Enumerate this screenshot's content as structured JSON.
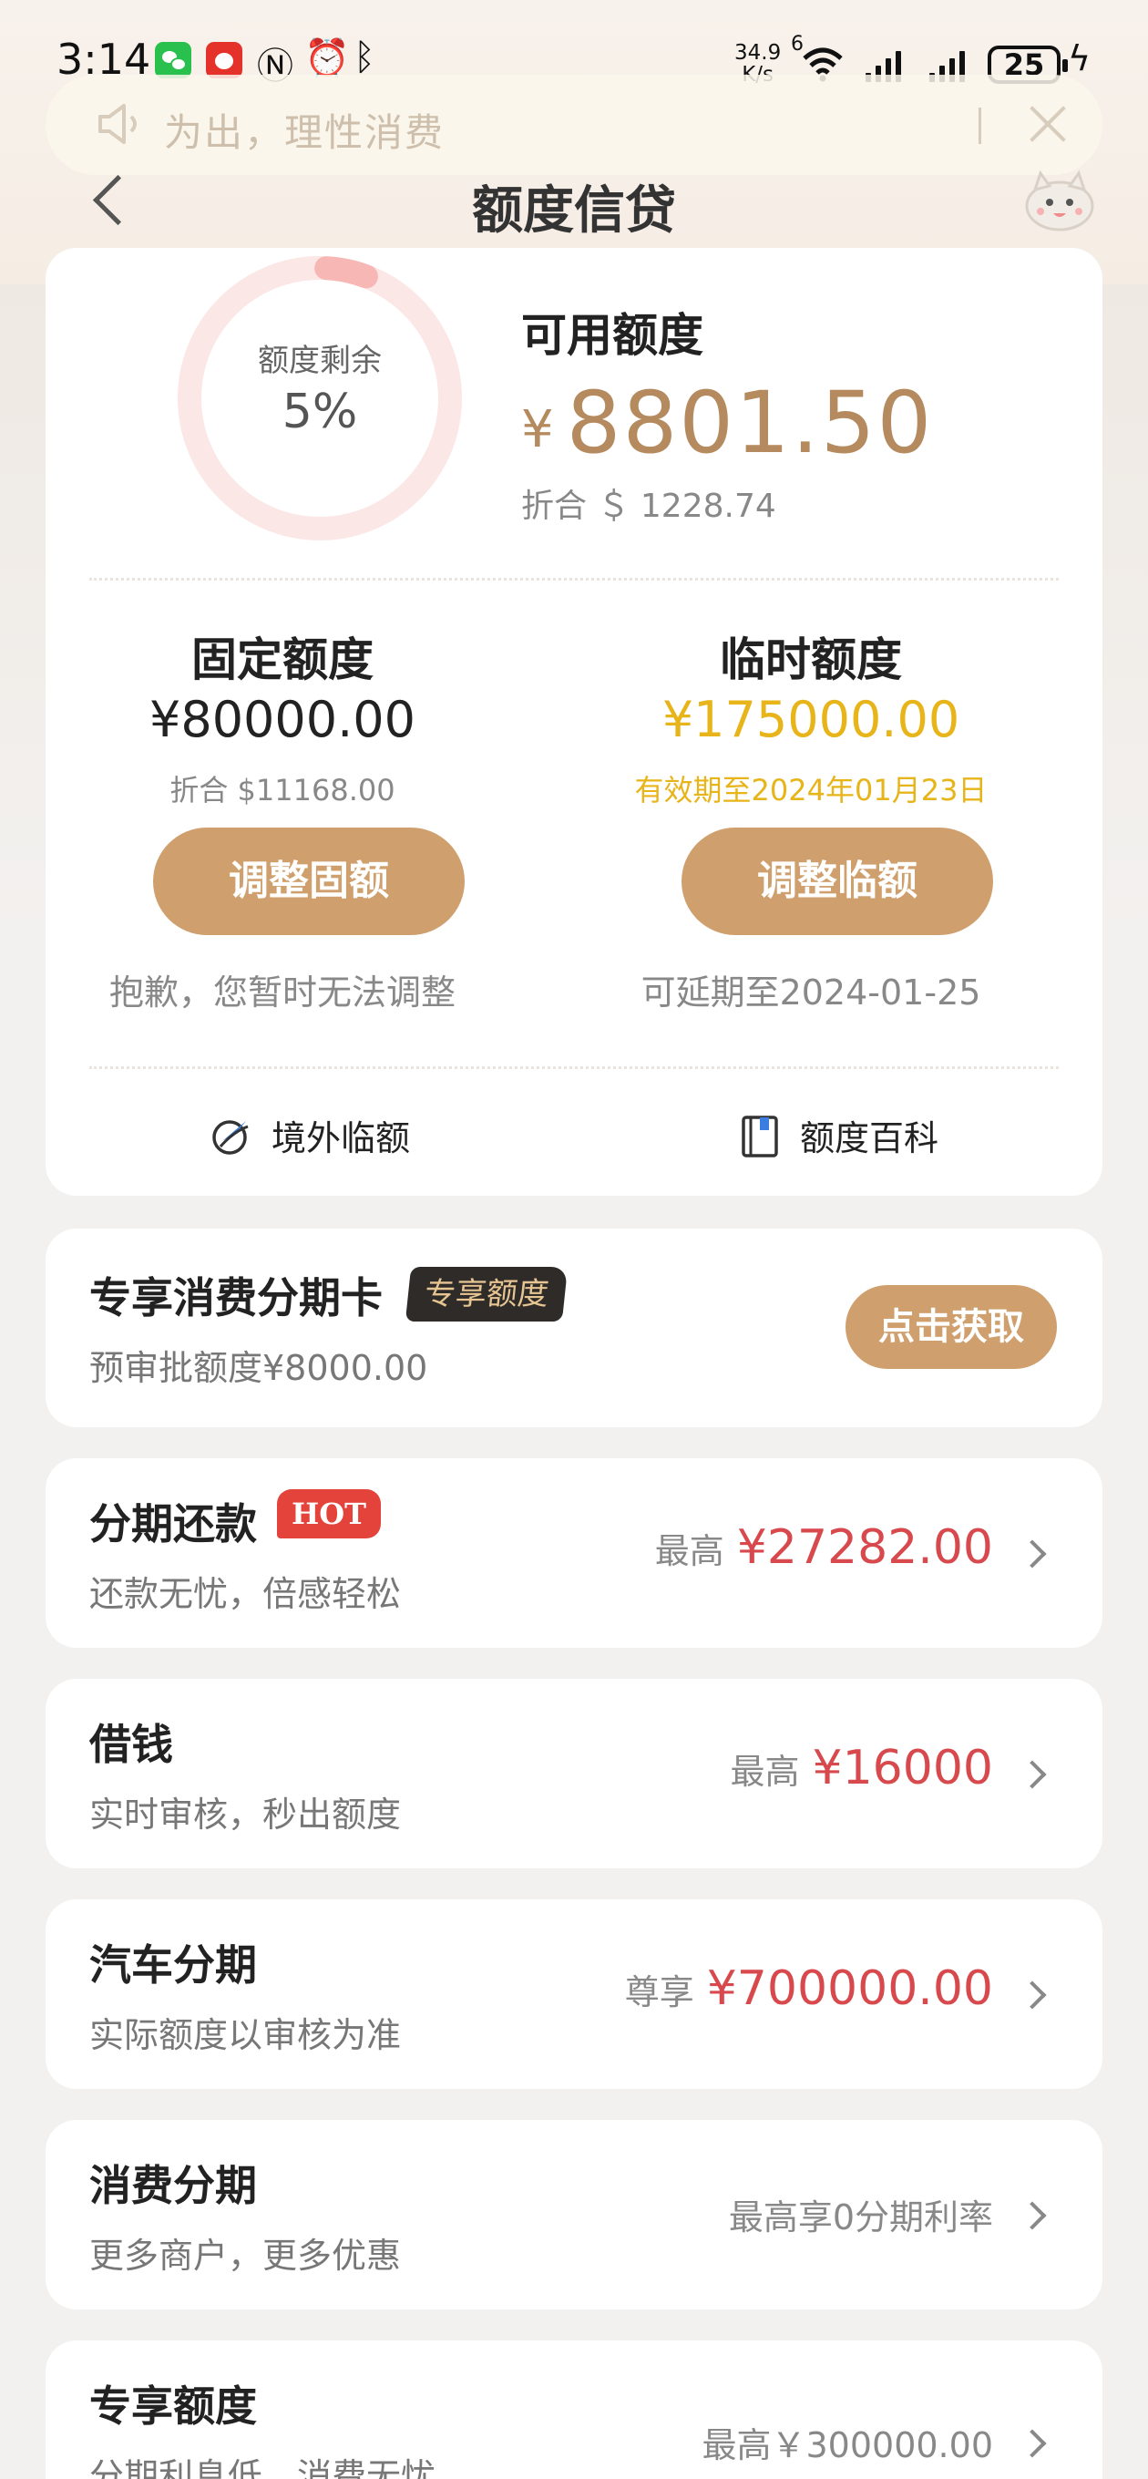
{
  "status_bar": {
    "time": "3:14",
    "net_speed_value": "34.9",
    "net_speed_unit": "K/s",
    "net_sup": "6",
    "battery": "25",
    "icons": [
      "wechat-icon",
      "jd-app-icon",
      "nfc-icon",
      "alarm-icon",
      "bluetooth-icon",
      "wifi-icon",
      "signal-icon",
      "battery-icon",
      "charging-icon"
    ]
  },
  "notice": {
    "text": "为出，理性消费"
  },
  "header": {
    "title": "额度信贷"
  },
  "credit": {
    "ring_label": "额度剩余",
    "ring_percent": "5%",
    "ring_fraction": 0.05,
    "available_label": "可用额度",
    "available_currency": "¥",
    "available_amount": "8801.50",
    "available_usd": "折合 ＄ 1228.74",
    "fixed": {
      "title": "固定额度",
      "amount": "¥80000.00",
      "sub": "折合 $11168.00",
      "button": "调整固额",
      "note": "抱歉，您暂时无法调整"
    },
    "temp": {
      "title": "临时额度",
      "amount": "¥175000.00",
      "sub": "有效期至2024年01月23日",
      "button": "调整临额",
      "note": "可延期至2024-01-25"
    },
    "links": {
      "overseas": "境外临额",
      "encyclopedia": "额度百科"
    }
  },
  "products": {
    "card_installment": {
      "title": "专享消费分期卡",
      "badge": "专享额度",
      "sub": "预审批额度¥8000.00",
      "button": "点击获取"
    },
    "bill_installment": {
      "title": "分期还款",
      "badge": "HOT",
      "sub": "还款无忧，倍感轻松",
      "prefix": "最高",
      "value": "¥27282.00"
    },
    "loan": {
      "title": "借钱",
      "sub": "实时审核，秒出额度",
      "prefix": "最高",
      "value": "¥16000"
    },
    "car": {
      "title": "汽车分期",
      "sub": "实际额度以审核为准",
      "prefix": "尊享",
      "value": "¥700000.00"
    },
    "consumer": {
      "title": "消费分期",
      "sub": "更多商户，更多优惠",
      "right": "最高享0分期利率"
    },
    "exclusive": {
      "title": "专享额度",
      "sub": "分期利息低，消费无忧",
      "right": "最高￥300000.00"
    }
  },
  "colors": {
    "accent_gold": "#cfa06d",
    "amount_brown": "#b48a5e",
    "temp_gold": "#e7b41a",
    "value_red": "#d8494d",
    "ring_pink": "#f7c9c9"
  }
}
